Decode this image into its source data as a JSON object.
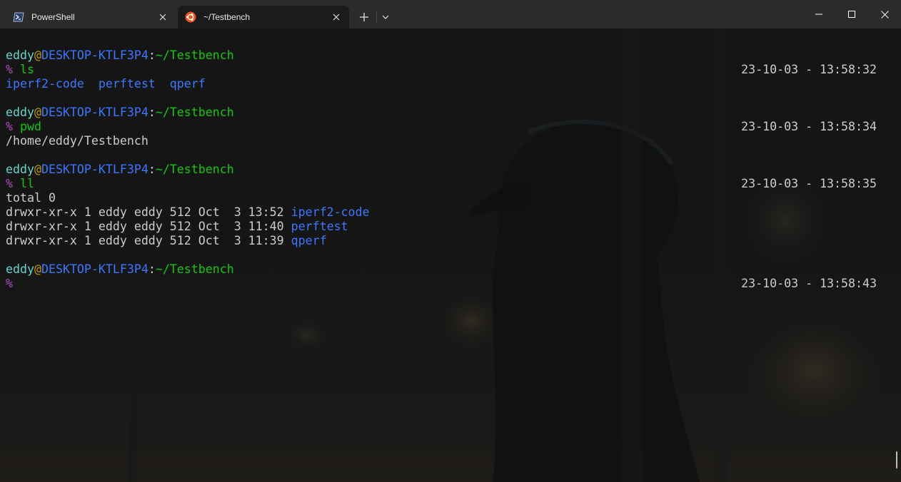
{
  "tabs": [
    {
      "title": "PowerShell",
      "icon": "powershell-icon",
      "active": false
    },
    {
      "title": "~/Testbench",
      "icon": "ubuntu-icon",
      "active": true
    }
  ],
  "titlebar": {
    "new_tab": "+",
    "dropdown": "⌄",
    "minimize": "—",
    "maximize": "□",
    "close": "✕"
  },
  "prompt": {
    "user": "eddy",
    "at": "@",
    "host": "DESKTOP-KTLF3P4",
    "colon": ":",
    "path": "~/Testbench",
    "symbol": "%"
  },
  "blocks": [
    {
      "command": "ls",
      "timestamp": "23-10-03 - 13:58:32",
      "output_dirs": "iperf2-code  perftest  qperf"
    },
    {
      "command": "pwd",
      "timestamp": "23-10-03 - 13:58:34",
      "output": "/home/eddy/Testbench"
    },
    {
      "command": "ll",
      "timestamp": "23-10-03 - 13:58:35",
      "total": "total 0",
      "listing": [
        {
          "meta": "drwxr-xr-x 1 eddy eddy 512 Oct  3 13:52 ",
          "name": "iperf2-code"
        },
        {
          "meta": "drwxr-xr-x 1 eddy eddy 512 Oct  3 11:40 ",
          "name": "perftest"
        },
        {
          "meta": "drwxr-xr-x 1 eddy eddy 512 Oct  3 11:39 ",
          "name": "qperf"
        }
      ]
    },
    {
      "command": "",
      "timestamp": "23-10-03 - 13:58:43"
    }
  ],
  "colors": {
    "background": "#141414",
    "tabbar": "#2b2b2b",
    "active_tab": "#1b1b1b",
    "user": "#61d6d6",
    "at": "#c19c00",
    "host": "#3b78ff",
    "path": "#16c60c",
    "prompt_symbol": "#b148c6",
    "directory": "#3b78ff",
    "text": "#cccccc"
  }
}
